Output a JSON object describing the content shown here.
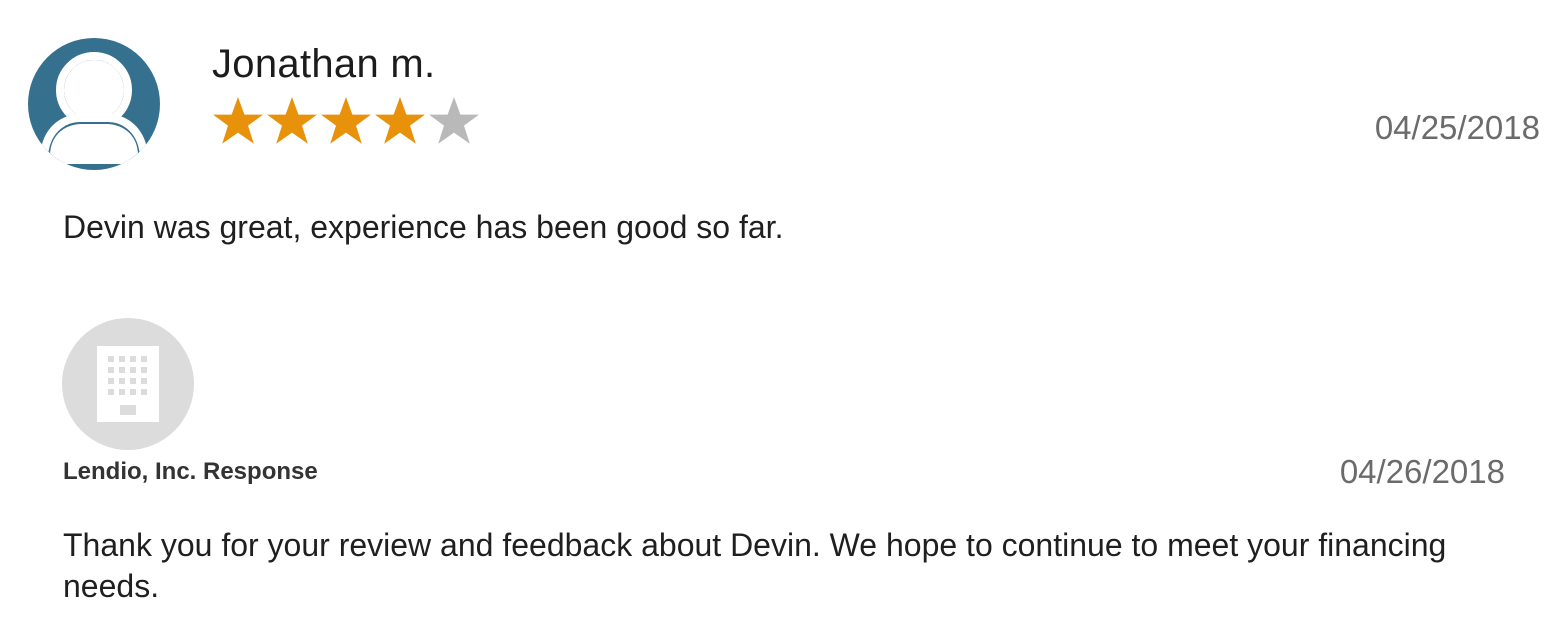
{
  "review": {
    "reviewer_name": "Jonathan m.",
    "rating": 4,
    "rating_max": 5,
    "date": "04/25/2018",
    "text": "Devin was great, experience has been good so far.",
    "avatar_icon": "user-avatar-icon"
  },
  "response": {
    "label": "Lendio, Inc. Response",
    "date": "04/26/2018",
    "text": "Thank you for your review and feedback about Devin. We hope to continue to meet your financing needs.",
    "avatar_icon": "company-building-icon"
  },
  "colors": {
    "avatar_bg": "#36708f",
    "star_filled": "#e8920c",
    "star_empty": "#b9b9b9",
    "company_avatar_bg": "#dcdcdc",
    "date_text": "#6b6b6b"
  }
}
